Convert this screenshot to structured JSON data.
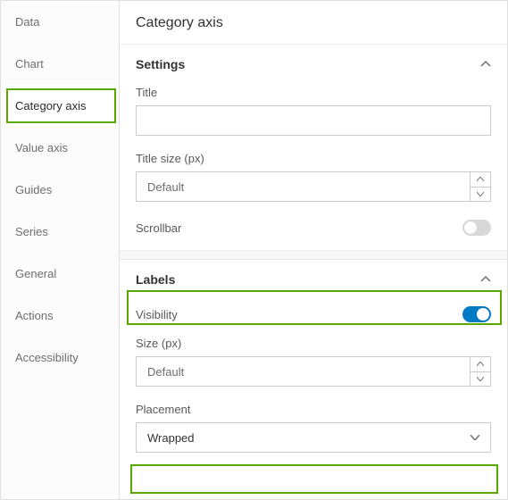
{
  "sidebar": {
    "items": [
      {
        "label": "Data"
      },
      {
        "label": "Chart"
      },
      {
        "label": "Category axis"
      },
      {
        "label": "Value axis"
      },
      {
        "label": "Guides"
      },
      {
        "label": "Series"
      },
      {
        "label": "General"
      },
      {
        "label": "Actions"
      },
      {
        "label": "Accessibility"
      }
    ],
    "active_index": 2
  },
  "page": {
    "title": "Category axis"
  },
  "settings": {
    "header": "Settings",
    "title_label": "Title",
    "title_value": "",
    "title_size_label": "Title size (px)",
    "title_size_value": "Default",
    "scrollbar_label": "Scrollbar",
    "scrollbar_on": false
  },
  "labels": {
    "header": "Labels",
    "visibility_label": "Visibility",
    "visibility_on": true,
    "size_label": "Size (px)",
    "size_value": "Default",
    "placement_label": "Placement",
    "placement_value": "Wrapped"
  }
}
